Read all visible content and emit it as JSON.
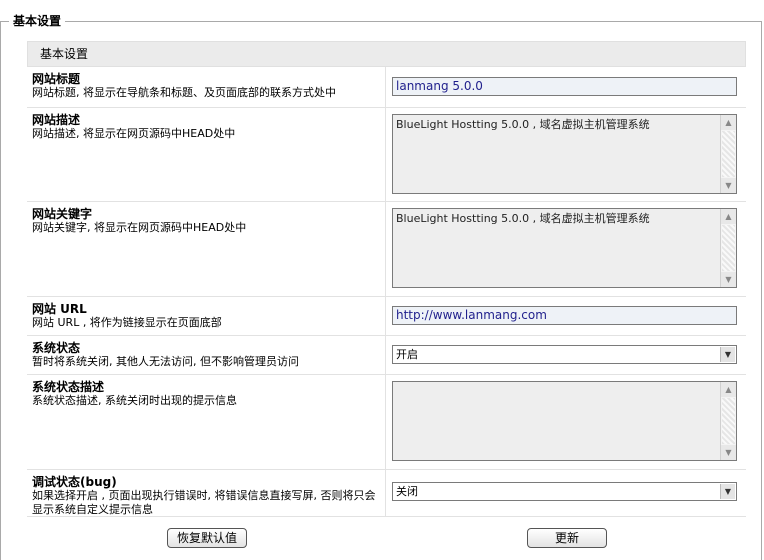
{
  "fieldset": {
    "legend": "基本设置"
  },
  "panel": {
    "header": "基本设置"
  },
  "site_title": {
    "title": "网站标题",
    "desc": "网站标题, 将显示在导航条和标题、及页面底部的联系方式处中",
    "value": "lanmang  5.0.0"
  },
  "site_desc": {
    "title": "网站描述",
    "desc": "网站描述, 将显示在网页源码中HEAD处中",
    "value": "BlueLight Hostting 5.0.0 , 域名虚拟主机管理系统"
  },
  "site_keywords": {
    "title": "网站关键字",
    "desc": "网站关键字, 将显示在网页源码中HEAD处中",
    "value": "BlueLight Hostting 5.0.0 , 域名虚拟主机管理系统"
  },
  "site_url": {
    "title": "网站 URL",
    "desc": "网站 URL , 将作为链接显示在页面底部",
    "value": "http://www.lanmang.com"
  },
  "system_status": {
    "title": "系统状态",
    "desc": "暂时将系统关闭, 其他人无法访问, 但不影响管理员访问",
    "selected": "开启"
  },
  "system_status_desc": {
    "title": "系统状态描述",
    "desc": "系统状态描述, 系统关闭时出现的提示信息",
    "value": ""
  },
  "debug_status": {
    "title": "调试状态(bug)",
    "desc": "如果选择开启 , 页面出现执行错误时, 将错误信息直接写屏, 否则将只会显示系统自定义提示信息",
    "selected": "关闭"
  },
  "buttons": {
    "restore": "恢复默认值",
    "update": "更新"
  },
  "icons": {
    "scroll_up": "scroll-up-icon",
    "scroll_down": "scroll-down-icon",
    "dropdown": "chevron-down-icon"
  }
}
